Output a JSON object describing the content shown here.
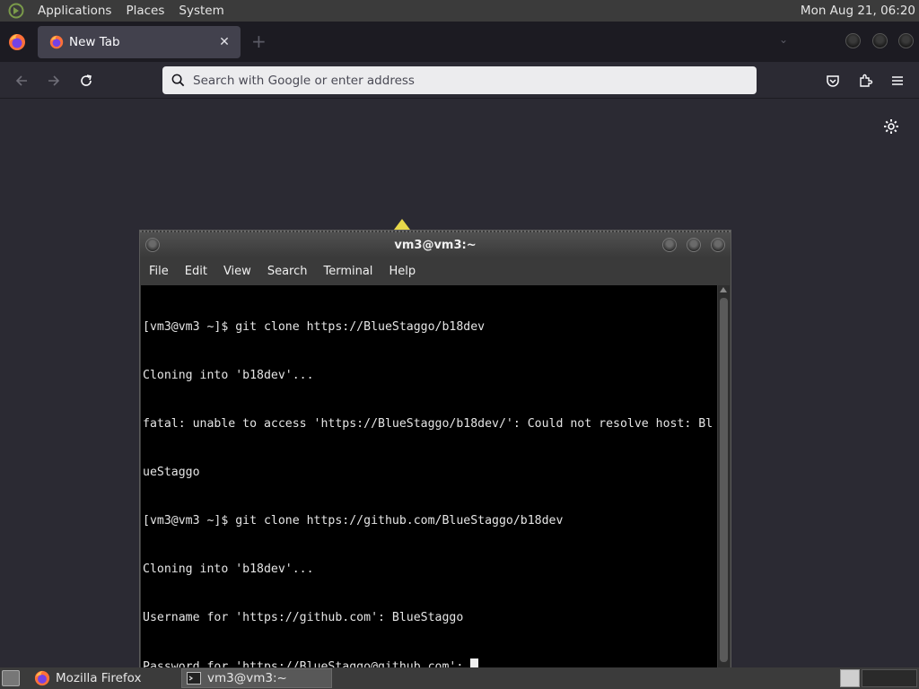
{
  "top_panel": {
    "menus": [
      "Applications",
      "Places",
      "System"
    ],
    "clock": "Mon Aug 21, 06:20"
  },
  "browser": {
    "tab_title": "New Tab",
    "address_placeholder": "Search with Google or enter address"
  },
  "terminal": {
    "title": "vm3@vm3:~",
    "menus": [
      "File",
      "Edit",
      "View",
      "Search",
      "Terminal",
      "Help"
    ],
    "lines": [
      "[vm3@vm3 ~]$ git clone https://BlueStaggo/b18dev",
      "Cloning into 'b18dev'...",
      "fatal: unable to access 'https://BlueStaggo/b18dev/': Could not resolve host: Bl",
      "ueStaggo",
      "[vm3@vm3 ~]$ git clone https://github.com/BlueStaggo/b18dev",
      "Cloning into 'b18dev'...",
      "Username for 'https://github.com': BlueStaggo",
      "Password for 'https://BlueStaggo@github.com': "
    ]
  },
  "taskbar": {
    "items": [
      "Mozilla Firefox",
      "vm3@vm3:~"
    ]
  },
  "colors": {
    "terminal_bg": "#000000",
    "browser_bg": "#2b2a33",
    "panel_bg": "#3b3b3b",
    "highlight": "#e8d84a"
  }
}
